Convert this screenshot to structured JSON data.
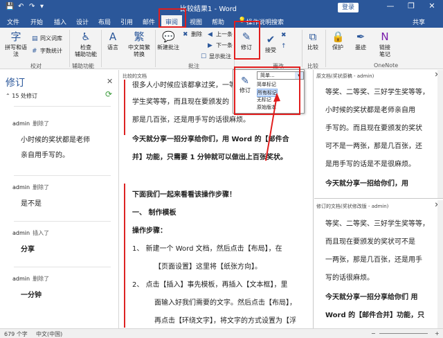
{
  "titlebar": {
    "title": "比较结果1 - Word",
    "login": "登录",
    "min": "—",
    "restore": "❐",
    "close": "✕"
  },
  "tabs": [
    {
      "label": "文件"
    },
    {
      "label": "开始"
    },
    {
      "label": "插入"
    },
    {
      "label": "设计"
    },
    {
      "label": "布局"
    },
    {
      "label": "引用"
    },
    {
      "label": "邮件"
    },
    {
      "label": "审阅"
    },
    {
      "label": "视图"
    },
    {
      "label": "帮助"
    },
    {
      "label": "操作说明搜索"
    },
    {
      "label": "共享"
    }
  ],
  "ribbon": {
    "spelling": "拼写和语法",
    "thesaurus": "同义词库",
    "wordcount": "字数统计",
    "proofing": "校对",
    "check": "检查",
    "accessibility": "辅助功能",
    "assist_group": "辅助功能",
    "language": "语言",
    "chinese": "中文简繁",
    "convert": "转换",
    "new_comment": "新建批注",
    "delete": "删除",
    "prev": "上一条",
    "next": "下一条",
    "show_comments": "显示批注",
    "comments_group": "批注",
    "track": "修订",
    "accept": "接受",
    "changes_group": "更改",
    "compare": "比较",
    "compare_group": "比较",
    "protect": "保护",
    "ink": "墨迹",
    "onenote_link": "链接",
    "onenote_note": "笔记",
    "onenote_group": "OneNote"
  },
  "revisions_pane": {
    "title": "修订",
    "count": "15 处修订",
    "items": [
      {
        "author": "admin",
        "action": "删除了",
        "text": "小时候的奖状都是老师亲自用手写的。"
      },
      {
        "author": "admin",
        "action": "删除了",
        "text": "是不是"
      },
      {
        "author": "admin",
        "action": "插入了",
        "text": "分享"
      },
      {
        "author": "admin",
        "action": "删除了",
        "text": "一分钟"
      }
    ]
  },
  "compared": {
    "label": "比较的文档",
    "lines": [
      "很多人小时候应该都拿过奖，一等",
      "学生奖等等，而且现在要颁发的",
      "那是几百张，还是用手写的话很麻烦。",
      "今天就分享一招分享给你们，用 Word 的【邮件合",
      "并】功能，只需要 1 分钟就可以做出上百张奖状。",
      "下面我们一起来看看该操作步骤！",
      "一、    制作模板",
      "操作步骤：",
      "1、    新建一个 Word 文档，然后点击【布局】，在",
      "【页面设置】这里将【纸张方向】。",
      "2、    点击【插入】事先模板，再插入【文本框】，里",
      "面输入好我们需要的文字。然后点击【布局】，",
      "再点击【环绕文字】，将文字的方式设置为【浮"
    ]
  },
  "original_doc": {
    "header": "原文档(奖状原稿 - admin)",
    "lines": [
      "等奖、二等奖、三好学生奖等等，",
      "小时候的奖状都是老师亲自用",
      "手写的。而且现在要颁发的奖状",
      "可不是一两张，那是几百张，还",
      "是用手写的话是不是很麻烦。",
      "今天就分享一招给你们，用"
    ]
  },
  "revised_doc": {
    "header": "修订的文档(奖状修改版 - admin)",
    "lines": [
      "等奖、二等奖、三好学生奖等等，",
      "而且现在要颁发的奖状可不是",
      "一两张，那是几百张，还是用手",
      "写的话很麻烦。",
      "今天就分享一招分享给你们 用",
      "Word 的【邮件合并】功能，只"
    ]
  },
  "popup": {
    "track_label": "修订",
    "dropdown": "简单...",
    "options": [
      "简单标记",
      "所有标记",
      "无标记",
      "原始版本"
    ],
    "selected": "所有标记"
  },
  "status": {
    "words": "679 个字",
    "lang": "中文(中国)",
    "zoom_minus": "−",
    "zoom_plus": "+"
  }
}
